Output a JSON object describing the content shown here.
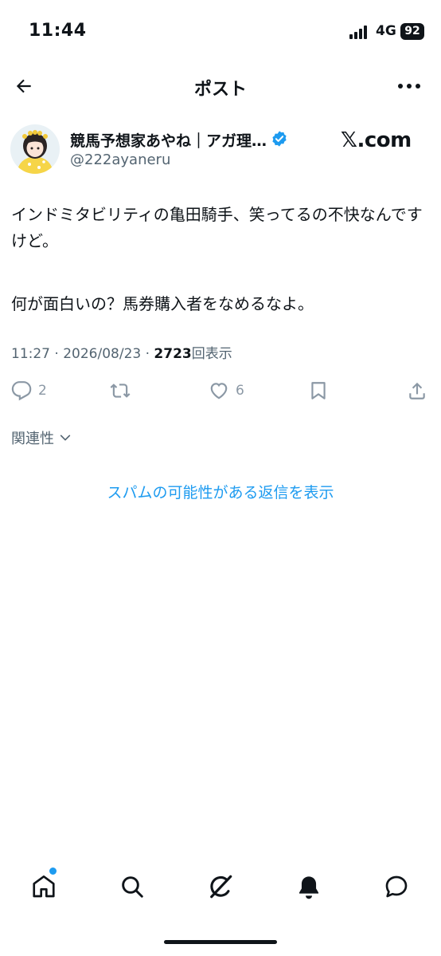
{
  "status_bar": {
    "time": "11:44",
    "network": "4G",
    "battery": "92"
  },
  "header": {
    "title": "ポスト"
  },
  "author": {
    "name": "競馬予想家あやね｜アガ理…",
    "handle": "@222ayaneru",
    "watermark": "𝕏.com",
    "verified_color": "#1d9bf0"
  },
  "post": {
    "line1": "インドミタビリティの亀田騎手、笑ってるの不快なんですけど。",
    "line2": "何が面白いの？馬券購入者をなめるなよ。",
    "time": "11:27",
    "date": "2026/08/23",
    "views": "2723",
    "views_label": "回表示",
    "sep": "·"
  },
  "actions": {
    "replies": "2",
    "likes": "6"
  },
  "related": {
    "label": "関連性"
  },
  "spam_link": {
    "label": "スパムの可能性がある返信を表示"
  },
  "icons": [
    "back-arrow-icon",
    "more-icon",
    "verified-icon",
    "reply-icon",
    "retweet-icon",
    "like-icon",
    "bookmark-icon",
    "share-icon",
    "chevron-down-icon",
    "home-icon",
    "search-icon",
    "grok-icon",
    "bell-icon",
    "message-icon"
  ],
  "colors": {
    "accent": "#1d9bf0",
    "text": "#0f1419",
    "muted": "#536471",
    "icon": "#8b98a5"
  }
}
